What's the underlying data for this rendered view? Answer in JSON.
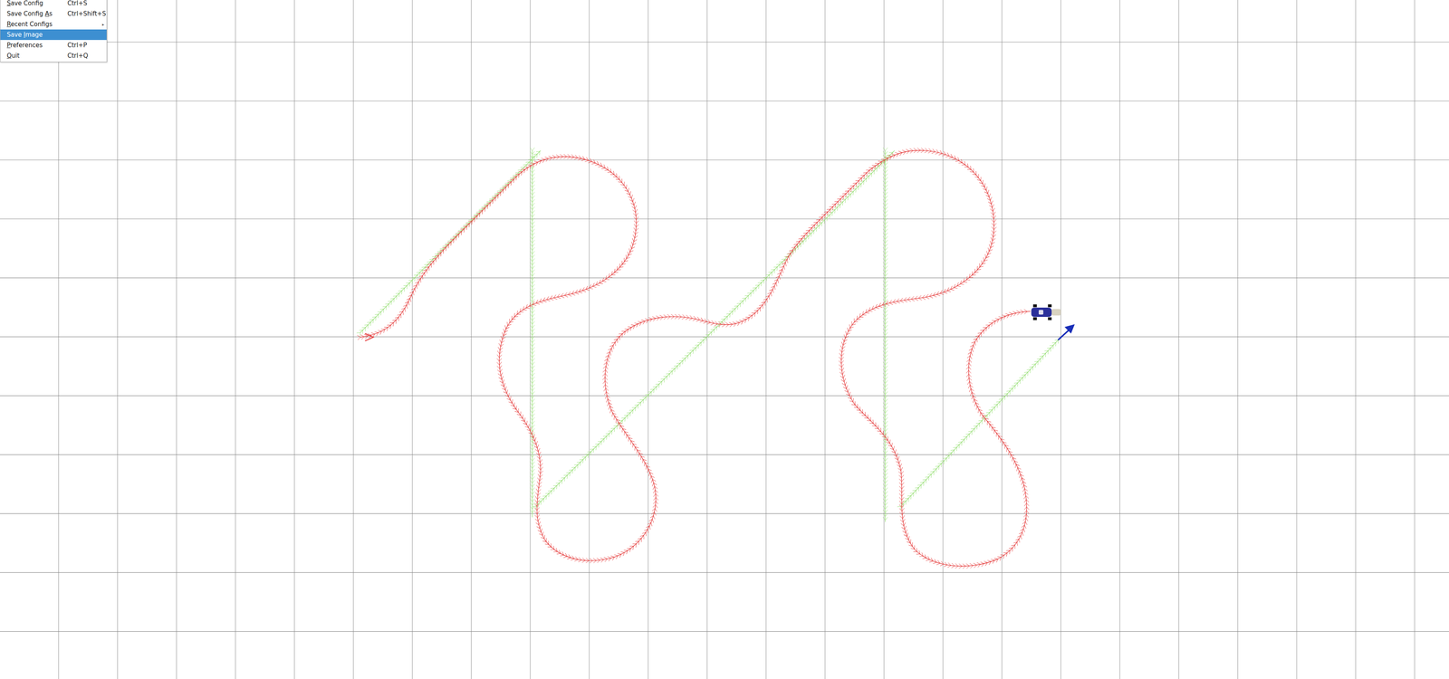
{
  "menu": {
    "items": [
      {
        "label": "Save Config",
        "shortcut": "Ctrl+S",
        "submenu": false,
        "selected": false,
        "mnemonic": 0
      },
      {
        "label": "Save Config As",
        "shortcut": "Ctrl+Shift+S",
        "submenu": false,
        "selected": false,
        "mnemonic": 12
      },
      {
        "label": "Recent Configs",
        "shortcut": "",
        "submenu": true,
        "selected": false,
        "mnemonic": 0
      },
      {
        "label": "Save Image",
        "shortcut": "",
        "submenu": false,
        "selected": true,
        "mnemonic": 5
      },
      {
        "label": "Preferences",
        "shortcut": "Ctrl+P",
        "submenu": false,
        "selected": false,
        "mnemonic": 0
      },
      {
        "label": "Quit",
        "shortcut": "Ctrl+Q",
        "submenu": false,
        "selected": false,
        "mnemonic": 0
      }
    ]
  }
}
